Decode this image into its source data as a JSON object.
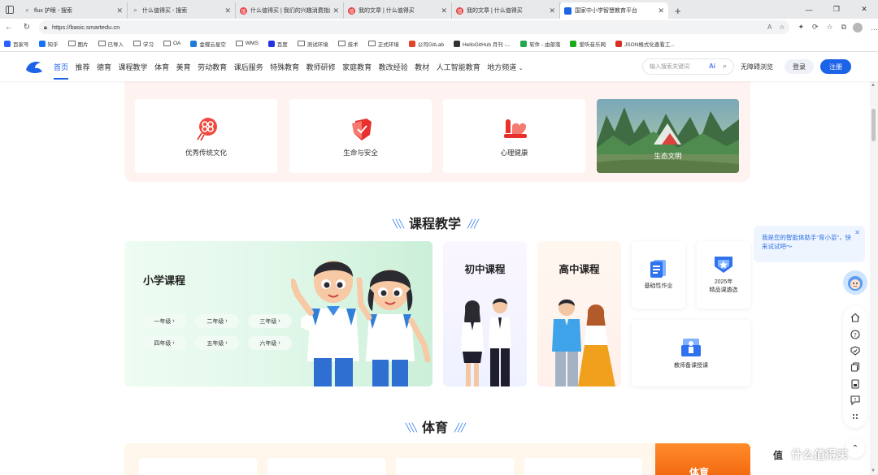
{
  "browser": {
    "tabs": [
      {
        "title": "flux 护眼 - 搜索",
        "icon_color": "#5f6368",
        "active": false
      },
      {
        "title": "什么值得买 - 搜索",
        "icon_color": "#5f6368",
        "active": false
      },
      {
        "title": "什么值得买 | 我们的兴趣消费指南",
        "icon_color": "#e4393c",
        "active": false
      },
      {
        "title": "我的文章 | 什么值得买",
        "icon_color": "#e4393c",
        "active": false
      },
      {
        "title": "我的文章 | 什么值得买",
        "icon_color": "#e4393c",
        "active": false
      },
      {
        "title": "国家中小学智慧教育平台",
        "icon_color": "#1d63e8",
        "active": true
      }
    ],
    "url": "https://basic.smartedu.cn",
    "bookmarks": [
      {
        "label": "百家号",
        "icon": "paw-icon",
        "color": "#2b5fff"
      },
      {
        "label": "知乎",
        "icon": "zhihu-icon",
        "color": "#1772f6"
      },
      {
        "label": "图片",
        "icon": "folder-icon"
      },
      {
        "label": "已导入",
        "icon": "folder-icon"
      },
      {
        "label": "学习",
        "icon": "folder-icon"
      },
      {
        "label": "OA",
        "icon": "folder-icon"
      },
      {
        "label": "金蝶云星空",
        "icon": "kingdee-icon",
        "color": "#1f7ad9"
      },
      {
        "label": "WMS",
        "icon": "folder-icon"
      },
      {
        "label": "百度",
        "icon": "paw-icon",
        "color": "#2932e1"
      },
      {
        "label": "测试环境",
        "icon": "folder-icon"
      },
      {
        "label": "技术",
        "icon": "folder-icon"
      },
      {
        "label": "正式环境",
        "icon": "folder-icon"
      },
      {
        "label": "公司GitLab",
        "icon": "gitlab-icon",
        "color": "#e24329"
      },
      {
        "label": "HelloGitHub 月刊 -...",
        "icon": "github-icon",
        "color": "#333333"
      },
      {
        "label": "软件 - 由部落",
        "icon": "circle-icon",
        "color": "#22a74a"
      },
      {
        "label": "爱听音乐网",
        "icon": "music-icon",
        "color": "#1aad19"
      },
      {
        "label": "JSON格式化查看工...",
        "icon": "json-icon",
        "color": "#d93025"
      }
    ]
  },
  "site": {
    "brand_color": "#1d63e8",
    "menu": [
      "首页",
      "推荐",
      "德育",
      "课程教学",
      "体育",
      "美育",
      "劳动教育",
      "课后服务",
      "特殊教育",
      "教师研修",
      "家庭教育",
      "教改经验",
      "教材",
      "人工智能教育",
      "地方频道"
    ],
    "search_placeholder": "输入搜索关键词",
    "search_ai_label": "Ai",
    "barrier_free": "无障碍浏览",
    "login": "登录",
    "register": "注册"
  },
  "moral": {
    "cards": [
      "优秀传统文化",
      "生命与安全",
      "心理健康"
    ],
    "feature": "生态文明"
  },
  "course": {
    "section_title": "课程教学",
    "primary_title": "小学课程",
    "grades": [
      "一年级",
      "二年级",
      "三年级",
      "四年级",
      "五年级",
      "六年级"
    ],
    "middle": "初中课程",
    "high": "高中课程",
    "basic_homework": "基础性作业",
    "selected_lessons_line1": "2025年",
    "selected_lessons_line2": "精品课遴选",
    "teacher_prep": "教师备课授课"
  },
  "sports": {
    "section_title": "体育",
    "banner": "体育"
  },
  "assistant": {
    "message": "我是您的智能体助手“育小苗”，快来试试吧～"
  },
  "watermark": {
    "text": "什么值得买",
    "badge": "值"
  }
}
